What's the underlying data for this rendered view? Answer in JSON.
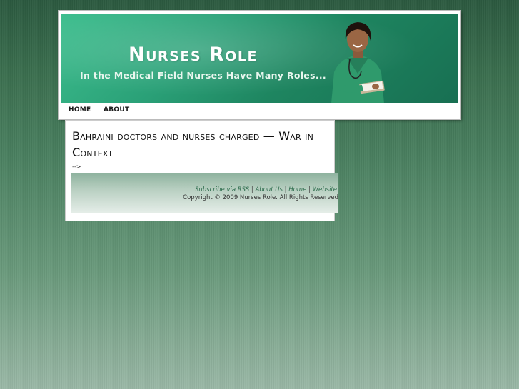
{
  "site": {
    "title": "Nurses Role",
    "tagline": "In the Medical Field Nurses Have Many Roles..."
  },
  "nav": {
    "items": [
      {
        "label": "HOME"
      },
      {
        "label": "ABOUT"
      }
    ]
  },
  "post": {
    "title": "Bahraini doctors and nurses charged — War in Context",
    "stray_text": "-->"
  },
  "footer": {
    "links": [
      {
        "label": "Subscribe via RSS"
      },
      {
        "label": "About Us"
      },
      {
        "label": "Home"
      },
      {
        "label": "Website"
      }
    ],
    "separator": "|",
    "copyright": "Copyright © 2009 Nurses Role. All Rights Reserved"
  },
  "colors": {
    "banner": "#1e8560",
    "background": "#4a8060",
    "link": "#2a6a4a"
  },
  "icons": {
    "header_image": "nurse-photo"
  }
}
